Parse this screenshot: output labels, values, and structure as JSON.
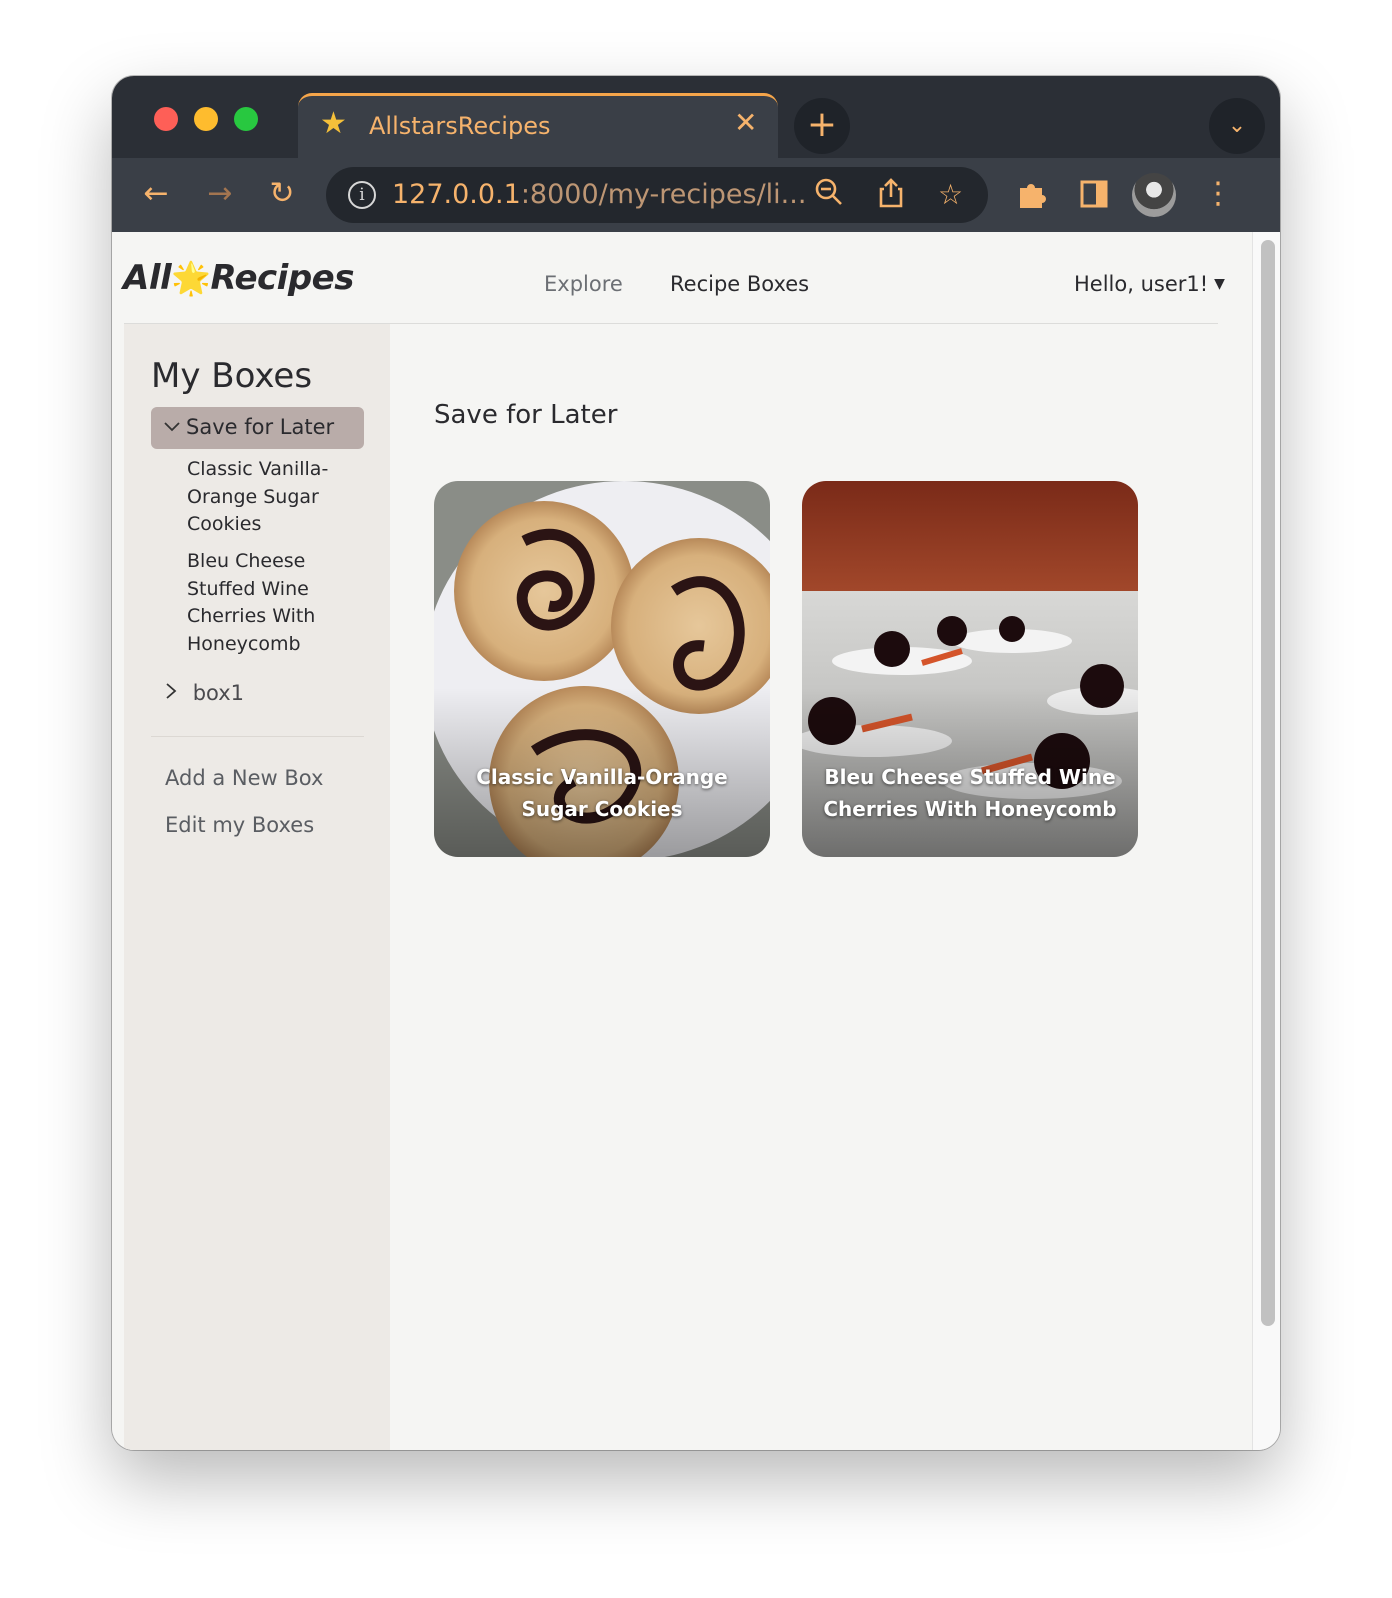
{
  "browser": {
    "tab_title": "AllstarsRecipes",
    "tab_icon": "star-icon",
    "tab_close": "✕",
    "new_tab": "+",
    "url_host": "127.0.0.1",
    "url_rest": ":8000/my-recipes/li...",
    "accent_color": "#f6b36c"
  },
  "site": {
    "logo_left": "All",
    "logo_right": "Recipes",
    "nav": {
      "explore": "Explore",
      "recipe_boxes": "Recipe Boxes",
      "user_greeting": "Hello, user1!"
    }
  },
  "sidebar": {
    "title": "My Boxes",
    "active_box": "Save for Later",
    "active_recipes": [
      "Classic Vanilla-Orange Sugar Cookies",
      "Bleu Cheese Stuffed Wine Cherries With Honeycomb"
    ],
    "other_boxes": [
      "box1"
    ],
    "add_box": "Add a New Box",
    "edit_boxes": "Edit my Boxes"
  },
  "main": {
    "title": "Save for Later",
    "cards": [
      {
        "title": "Classic Vanilla-Orange Sugar Cookies"
      },
      {
        "title": "Bleu Cheese Stuffed Wine Cherries With Honeycomb"
      }
    ]
  }
}
